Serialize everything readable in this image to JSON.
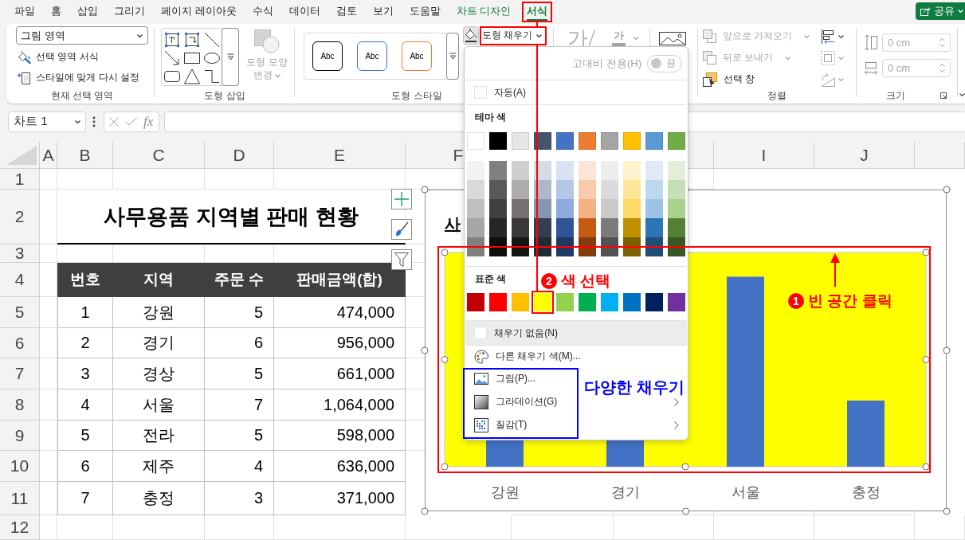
{
  "tabs": [
    {
      "label": "파일",
      "kind": "standard",
      "selected": false
    },
    {
      "label": "홈",
      "kind": "standard",
      "selected": false
    },
    {
      "label": "삽입",
      "kind": "standard",
      "selected": false
    },
    {
      "label": "그리기",
      "kind": "standard",
      "selected": false
    },
    {
      "label": "페이지 레이아웃",
      "kind": "standard",
      "selected": false
    },
    {
      "label": "수식",
      "kind": "standard",
      "selected": false
    },
    {
      "label": "데이터",
      "kind": "standard",
      "selected": false
    },
    {
      "label": "검토",
      "kind": "standard",
      "selected": false
    },
    {
      "label": "보기",
      "kind": "standard",
      "selected": false
    },
    {
      "label": "도움말",
      "kind": "standard",
      "selected": false
    },
    {
      "label": "차트 디자인",
      "kind": "contextual",
      "selected": false
    },
    {
      "label": "서식",
      "kind": "contextual",
      "selected": true
    }
  ],
  "share_button": {
    "label": "공유"
  },
  "ribbon": {
    "current_selection": {
      "label": "현재 선택 영역",
      "element": "그림 영역",
      "format_button": "선택 영역 서식",
      "reset_button": "스타일에 맞게 다시 설정"
    },
    "insert_shapes": {
      "label": "도형 삽입",
      "change_shape": {
        "label": "도형 모양 변경",
        "disabled": true
      }
    },
    "shape_styles": {
      "label": "도형 스타일",
      "presets": [
        {
          "text": "Abc",
          "color": "#000000"
        },
        {
          "text": "Abc",
          "color": "#4472c4"
        },
        {
          "text": "Abc",
          "color": "#ed7d31"
        }
      ],
      "fill_button": {
        "label": "도형 채우기",
        "expanded": true
      }
    },
    "wordart": {
      "quick_style": "가",
      "text_fill": "가"
    },
    "arrange": {
      "label": "정렬",
      "commands": [
        {
          "label": "앞으로 가져오기",
          "disabled": true,
          "menu": true
        },
        {
          "label": "뒤로 보내기",
          "disabled": true,
          "menu": true
        },
        {
          "label": "선택 창",
          "disabled": false,
          "menu": false
        }
      ],
      "tools": [
        {
          "kind": "align",
          "disabled": false
        },
        {
          "kind": "group",
          "disabled": true
        },
        {
          "kind": "rotate",
          "disabled": true
        }
      ]
    },
    "size": {
      "label": "크기",
      "height": {
        "value": "0 cm",
        "disabled": true
      },
      "width": {
        "value": "0 cm",
        "disabled": true
      }
    }
  },
  "formula_bar": {
    "name_box": "차트 1",
    "function_label": "fx"
  },
  "sheet": {
    "columns": [
      "A",
      "B",
      "C",
      "D",
      "E",
      "F"
    ],
    "columns_after_menu": [
      "I",
      "J"
    ],
    "rows": [
      "1",
      "2",
      "3",
      "4",
      "5",
      "6",
      "7",
      "8",
      "9",
      "10",
      "11",
      "12"
    ],
    "table": {
      "title": "사무용품 지역별 판매 현황",
      "columns": [
        "번호",
        "지역",
        "주문 수",
        "판매금액(합)"
      ],
      "rows": [
        [
          "1",
          "강원",
          "5",
          "474,000"
        ],
        [
          "2",
          "경기",
          "6",
          "956,000"
        ],
        [
          "3",
          "경상",
          "5",
          "661,000"
        ],
        [
          "4",
          "서울",
          "7",
          "1,064,000"
        ],
        [
          "5",
          "전라",
          "5",
          "598,000"
        ],
        [
          "6",
          "제주",
          "4",
          "636,000"
        ],
        [
          "7",
          "충정",
          "3",
          "371,000"
        ]
      ]
    },
    "chart": {
      "selected": true,
      "title": "사",
      "categories": [
        "강원",
        "경기",
        "서울",
        "충정"
      ]
    }
  },
  "fill_menu": {
    "high_contrast": {
      "label": "고대비 전용(H)",
      "on": false,
      "state_text": "끔"
    },
    "automatic_label": "자동(A)",
    "theme_label": "테마 색",
    "theme_colors": [
      {
        "color": "#ffffff",
        "shades": [
          {
            "color": "#f2f2f2"
          },
          {
            "color": "#d9d9d9"
          },
          {
            "color": "#bfbfbf"
          },
          {
            "color": "#a6a6a6"
          },
          {
            "color": "#808080"
          }
        ]
      },
      {
        "color": "#000000",
        "shades": [
          {
            "color": "#808080"
          },
          {
            "color": "#595959"
          },
          {
            "color": "#404040"
          },
          {
            "color": "#262626"
          },
          {
            "color": "#0d0d0d"
          }
        ]
      },
      {
        "color": "#e7e6e6",
        "shades": [
          {
            "color": "#d0cece"
          },
          {
            "color": "#aeabab"
          },
          {
            "color": "#757171"
          },
          {
            "color": "#3a3838"
          },
          {
            "color": "#171616"
          }
        ]
      },
      {
        "color": "#44546a",
        "shades": [
          {
            "color": "#d6dce5"
          },
          {
            "color": "#adb9ca"
          },
          {
            "color": "#8497b0"
          },
          {
            "color": "#333f50"
          },
          {
            "color": "#222a35"
          }
        ]
      },
      {
        "color": "#4472c4",
        "shades": [
          {
            "color": "#dae3f3"
          },
          {
            "color": "#b4c7e7"
          },
          {
            "color": "#8faadc"
          },
          {
            "color": "#2f5597"
          },
          {
            "color": "#1f3864"
          }
        ]
      },
      {
        "color": "#ed7d31",
        "shades": [
          {
            "color": "#fbe5d6"
          },
          {
            "color": "#f8cbad"
          },
          {
            "color": "#f4b183"
          },
          {
            "color": "#c55a11"
          },
          {
            "color": "#843c0c"
          }
        ]
      },
      {
        "color": "#a5a5a5",
        "shades": [
          {
            "color": "#ededed"
          },
          {
            "color": "#dbdbdb"
          },
          {
            "color": "#c9c9c9"
          },
          {
            "color": "#7b7b7b"
          },
          {
            "color": "#525252"
          }
        ]
      },
      {
        "color": "#ffc000",
        "shades": [
          {
            "color": "#fff2cc"
          },
          {
            "color": "#ffe699"
          },
          {
            "color": "#ffd966"
          },
          {
            "color": "#bf9000"
          },
          {
            "color": "#7f6000"
          }
        ]
      },
      {
        "color": "#5b9bd5",
        "shades": [
          {
            "color": "#deebf7"
          },
          {
            "color": "#bdd7ee"
          },
          {
            "color": "#9dc3e6"
          },
          {
            "color": "#2e75b6"
          },
          {
            "color": "#1f4e79"
          }
        ]
      },
      {
        "color": "#70ad47",
        "shades": [
          {
            "color": "#e2f0d9"
          },
          {
            "color": "#c5e0b4"
          },
          {
            "color": "#a9d18e"
          },
          {
            "color": "#548235"
          },
          {
            "color": "#385723"
          }
        ]
      }
    ],
    "standard_label": "표준 색",
    "standard_colors": [
      {
        "color": "#c00000",
        "selected": false
      },
      {
        "color": "#ff0000",
        "selected": false
      },
      {
        "color": "#ffc000",
        "selected": false
      },
      {
        "color": "#ffff00",
        "selected": true
      },
      {
        "color": "#92d050",
        "selected": false
      },
      {
        "color": "#00b050",
        "selected": false
      },
      {
        "color": "#00b0f0",
        "selected": false
      },
      {
        "color": "#0070c0",
        "selected": false
      },
      {
        "color": "#002060",
        "selected": false
      },
      {
        "color": "#7030a0",
        "selected": false
      }
    ],
    "items": [
      {
        "label": "채우기 없음(N)",
        "kind": "no_fill",
        "highlighted": true,
        "submenu": false
      },
      {
        "label": "다른 채우기 색(M)...",
        "kind": "more_colors",
        "highlighted": false,
        "submenu": false
      },
      {
        "label": "그림(P)...",
        "kind": "picture",
        "highlighted": false,
        "submenu": false
      },
      {
        "label": "그라데이션(G)",
        "kind": "gradient",
        "highlighted": false,
        "submenu": true
      },
      {
        "label": "질감(T)",
        "kind": "texture",
        "highlighted": false,
        "submenu": true
      }
    ]
  },
  "annotations": [
    {
      "kind": "step",
      "number": "1",
      "text": "빈 공간 클릭",
      "color": "#ff0000"
    },
    {
      "kind": "step",
      "number": "2",
      "text": "색 선택",
      "color": "#ff0000"
    },
    {
      "kind": "note",
      "text": "다양한 채우기",
      "color": "#0000ff"
    }
  ]
}
